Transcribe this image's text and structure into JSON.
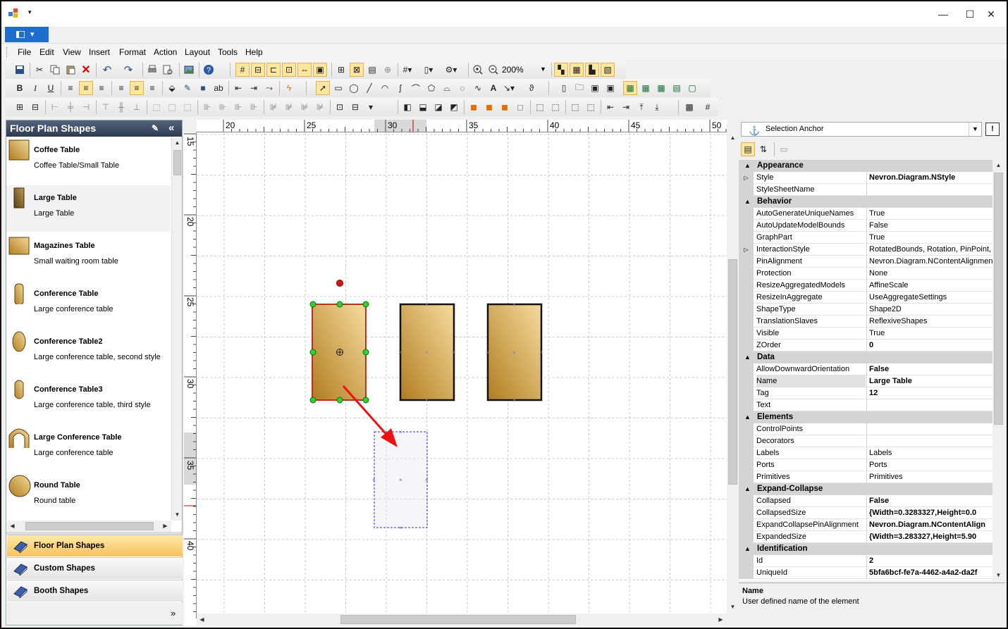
{
  "window": {
    "minimize": "—",
    "maximize": "☐",
    "close": "✕",
    "qat_arrow": "▾"
  },
  "ribbon_button": {
    "label": "▾"
  },
  "menu": [
    "File",
    "Edit",
    "View",
    "Insert",
    "Format",
    "Action",
    "Layout",
    "Tools",
    "Help"
  ],
  "toolbar": {
    "zoom_value": "200%"
  },
  "left_panel": {
    "title": "Floor Plan Shapes",
    "collapse_glyph": "«",
    "shapes": [
      {
        "name": "Coffee Table",
        "desc": "Coffee Table/Small Table"
      },
      {
        "name": "Large Table",
        "desc": "Large Table"
      },
      {
        "name": "Magazines Table",
        "desc": "Small waiting room table"
      },
      {
        "name": "Conference Table",
        "desc": "Large conference table"
      },
      {
        "name": "Conference Table2",
        "desc": "Large conference table, second style"
      },
      {
        "name": "Conference Table3",
        "desc": "Large conference table, third style"
      },
      {
        "name": "Large Conference Table",
        "desc": "Large conference table"
      },
      {
        "name": "Round Table",
        "desc": "Round table"
      }
    ],
    "categories": [
      "Floor Plan Shapes",
      "Custom Shapes",
      "Booth Shapes"
    ],
    "more_glyph": "»"
  },
  "rulers": {
    "h_labels": [
      "20",
      "25",
      "30",
      "35",
      "40",
      "45",
      "50"
    ],
    "v_labels": [
      "15",
      "20",
      "25",
      "30",
      "35",
      "40"
    ]
  },
  "property_grid": {
    "selected_object": "Selection Anchor",
    "pin_label": "!",
    "help_title": "Name",
    "help_desc": "User defined name of the element",
    "sections": [
      {
        "title": "Appearance",
        "rows": [
          {
            "key": "Style",
            "value": "Nevron.Diagram.NStyle",
            "bold": true,
            "expand": true
          },
          {
            "key": "StyleSheetName",
            "value": ""
          }
        ]
      },
      {
        "title": "Behavior",
        "rows": [
          {
            "key": "AutoGenerateUniqueNames",
            "value": "True"
          },
          {
            "key": "AutoUpdateModelBounds",
            "value": "False"
          },
          {
            "key": "GraphPart",
            "value": "True"
          },
          {
            "key": "InteractionStyle",
            "value": "RotatedBounds, Rotation, PinPoint, S",
            "expand": true
          },
          {
            "key": "PinAlignment",
            "value": "Nevron.Diagram.NContentAlignment"
          },
          {
            "key": "Protection",
            "value": "None"
          },
          {
            "key": "ResizeAggregatedModels",
            "value": "AffineScale"
          },
          {
            "key": "ResizeInAggregate",
            "value": "UseAggregateSettings"
          },
          {
            "key": "ShapeType",
            "value": "Shape2D"
          },
          {
            "key": "TranslationSlaves",
            "value": "ReflexiveShapes"
          },
          {
            "key": "Visible",
            "value": "True"
          },
          {
            "key": "ZOrder",
            "value": "0",
            "bold": true
          }
        ]
      },
      {
        "title": "Data",
        "rows": [
          {
            "key": "AllowDownwardOrientation",
            "value": "False",
            "bold": true
          },
          {
            "key": "Name",
            "value": "Large Table",
            "bold": true,
            "selected": true
          },
          {
            "key": "Tag",
            "value": "12",
            "bold": true
          },
          {
            "key": "Text",
            "value": ""
          }
        ]
      },
      {
        "title": "Elements",
        "rows": [
          {
            "key": "ControlPoints",
            "value": ""
          },
          {
            "key": "Decorators",
            "value": ""
          },
          {
            "key": "Labels",
            "value": "Labels"
          },
          {
            "key": "Ports",
            "value": "Ports"
          },
          {
            "key": "Primitives",
            "value": "Primitives"
          }
        ]
      },
      {
        "title": "Expand-Collapse",
        "rows": [
          {
            "key": "Collapsed",
            "value": "False",
            "bold": true
          },
          {
            "key": "CollapsedSize",
            "value": "{Width=0.3283327,Height=0.0",
            "bold": true
          },
          {
            "key": "ExpandCollapsePinAlignment",
            "value": "Nevron.Diagram.NContentAlign",
            "bold": true
          },
          {
            "key": "ExpandedSize",
            "value": "{Width=3.283327,Height=5.90",
            "bold": true
          }
        ]
      },
      {
        "title": "Identification",
        "rows": [
          {
            "key": "Id",
            "value": "2",
            "bold": true
          },
          {
            "key": "UniqueId",
            "value": "5bfa6bcf-fe7a-4462-a4a2-da2f",
            "bold": true
          }
        ]
      }
    ]
  },
  "colors": {
    "accent": "#1e6ecf",
    "selection": "#f7c25e",
    "table_light": "#f3d89a",
    "table_dark": "#b07d1f",
    "arrow": "#ee1111"
  }
}
